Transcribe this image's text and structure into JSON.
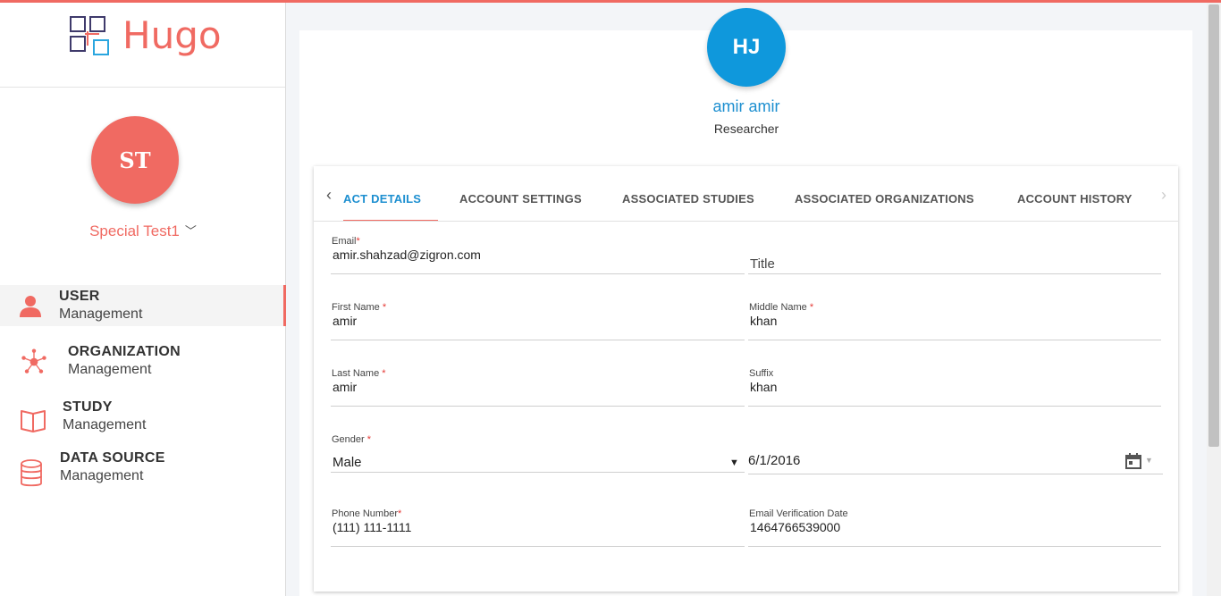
{
  "app": {
    "name": "Hugo"
  },
  "current_user": {
    "initials": "ST",
    "name": "Special Test1"
  },
  "nav": [
    {
      "title": "USER",
      "sub": "Management",
      "icon": "user-icon"
    },
    {
      "title": "ORGANIZATION",
      "sub": "Management",
      "icon": "network-icon"
    },
    {
      "title": "STUDY",
      "sub": "Management",
      "icon": "book-icon"
    },
    {
      "title": "DATA SOURCE",
      "sub": "Management",
      "icon": "database-icon"
    }
  ],
  "profile": {
    "initials": "HJ",
    "name": "amir amir",
    "role": "Researcher"
  },
  "tabs": [
    "ACT DETAILS",
    "ACCOUNT SETTINGS",
    "ASSOCIATED STUDIES",
    "ASSOCIATED ORGANIZATIONS",
    "ACCOUNT HISTORY"
  ],
  "form": {
    "email": {
      "label": "Email",
      "value": "amir.shahzad@zigron.com"
    },
    "title": {
      "placeholder": "Title"
    },
    "first_name": {
      "label": "First Name",
      "value": "amir"
    },
    "middle_name": {
      "label": "Middle Name",
      "value": "khan"
    },
    "last_name": {
      "label": "Last Name",
      "value": "amir"
    },
    "suffix": {
      "label": "Suffix",
      "value": "khan"
    },
    "gender": {
      "label": "Gender",
      "value": "Male"
    },
    "date": {
      "value": "6/1/2016"
    },
    "phone": {
      "label": "Phone Number",
      "value": "(111) 111-1111"
    },
    "email_verification": {
      "label": "Email Verification Date",
      "value": "1464766539000"
    }
  },
  "colors": {
    "accent": "#f06a62",
    "primary": "#0f98dc",
    "link": "#1d8fd0"
  }
}
